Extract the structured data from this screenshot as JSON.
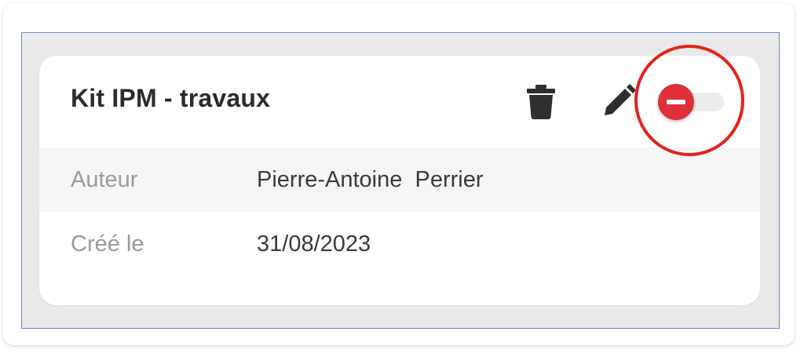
{
  "card": {
    "title": "Kit IPM - travaux",
    "actions": {
      "delete_icon": "trash-icon",
      "edit_icon": "pencil-icon",
      "toggle_state": "off",
      "toggle_knob_icon": "minus-icon",
      "toggle_knob_color": "#df3037"
    },
    "fields": [
      {
        "label": "Auteur",
        "value": "Pierre-Antoine  Perrier"
      },
      {
        "label": "Créé le",
        "value": "31/08/2023"
      }
    ]
  },
  "colors": {
    "frame_border": "#6f86cf",
    "highlight": "#e2231a"
  }
}
